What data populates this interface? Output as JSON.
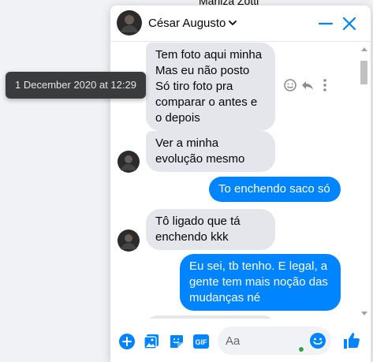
{
  "background": {
    "contact_name": "Marilza Zotti"
  },
  "header": {
    "name": "César Augusto"
  },
  "tooltip": {
    "text": "1 December 2020 at 12:29"
  },
  "messages": [
    {
      "from": "them",
      "lines": [
        "Tem foto aqui minha",
        "Mas eu não posto",
        "Só tiro foto pra",
        "comparar o antes e",
        "o depois"
      ]
    },
    {
      "from": "them",
      "lines": [
        "Ver a minha",
        "evolução mesmo"
      ]
    },
    {
      "from": "me",
      "lines": [
        "To enchendo saco só"
      ]
    },
    {
      "from": "them",
      "lines": [
        "Tô ligado que tá",
        "enchendo kkk"
      ]
    },
    {
      "from": "me",
      "lines": [
        "Eu sei, tb tenho. E legal, a",
        "gente tem mais noção das",
        "mudanças né"
      ]
    }
  ],
  "composer": {
    "placeholder": "Aa"
  },
  "colors": {
    "accent": "#0084ff",
    "incoming_bubble": "#e4e6eb",
    "online": "#31a24c"
  },
  "icons": [
    "chevron-down-icon",
    "minimize-icon",
    "close-icon",
    "emoji-react-icon",
    "reply-icon",
    "more-options-icon",
    "plus-icon",
    "image-icon",
    "sticker-icon",
    "gif-icon",
    "emoji-icon",
    "thumbs-up-icon"
  ]
}
